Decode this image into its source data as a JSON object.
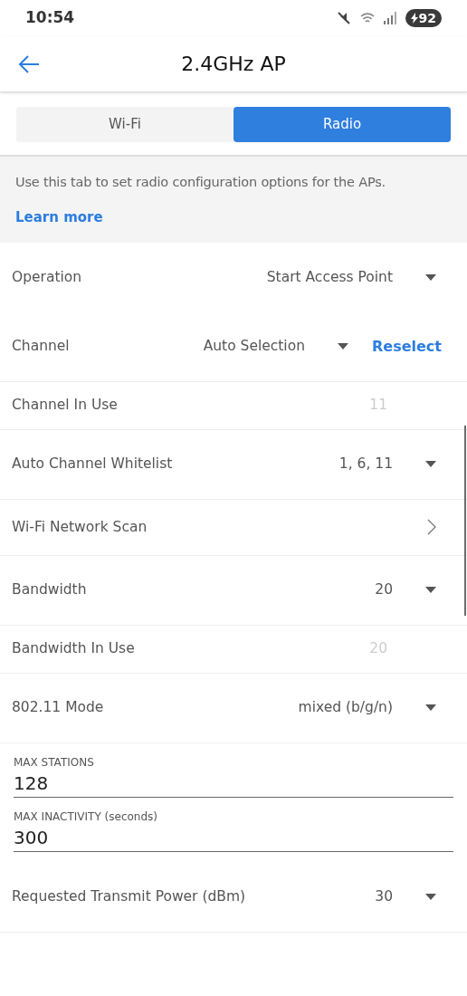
{
  "status_bar": {
    "time": "10:54",
    "battery": "92"
  },
  "header": {
    "title": "2.4GHz AP"
  },
  "tabs": [
    {
      "label": "Wi-Fi",
      "selected": false
    },
    {
      "label": "Radio",
      "selected": true
    }
  ],
  "info": {
    "text": "Use this tab to set radio configuration options for the APs.",
    "link": "Learn more"
  },
  "rows": [
    {
      "kind": "dropdown",
      "label": "Operation",
      "value": "Start Access Point"
    },
    {
      "kind": "dropdown_action",
      "label": "Channel",
      "value": "Auto Selection",
      "action": "Reselect"
    },
    {
      "kind": "readonly",
      "label": "Channel In Use",
      "value": "11"
    },
    {
      "kind": "dropdown",
      "label": "Auto Channel Whitelist",
      "value": "1, 6, 11"
    },
    {
      "kind": "chevron",
      "label": "Wi-Fi Network Scan"
    },
    {
      "kind": "dropdown",
      "label": "Bandwidth",
      "value": "20"
    },
    {
      "kind": "readonly",
      "label": "Bandwidth In Use",
      "value": "20"
    },
    {
      "kind": "dropdown",
      "label": "802.11 Mode",
      "value": "mixed (b/g/n)"
    },
    {
      "kind": "field",
      "label": "MAX STATIONS",
      "value": "128"
    },
    {
      "kind": "field",
      "label": "MAX INACTIVITY (seconds)",
      "value": "300"
    },
    {
      "kind": "dropdown",
      "label": "Requested Transmit Power (dBm)",
      "value": "30"
    }
  ]
}
